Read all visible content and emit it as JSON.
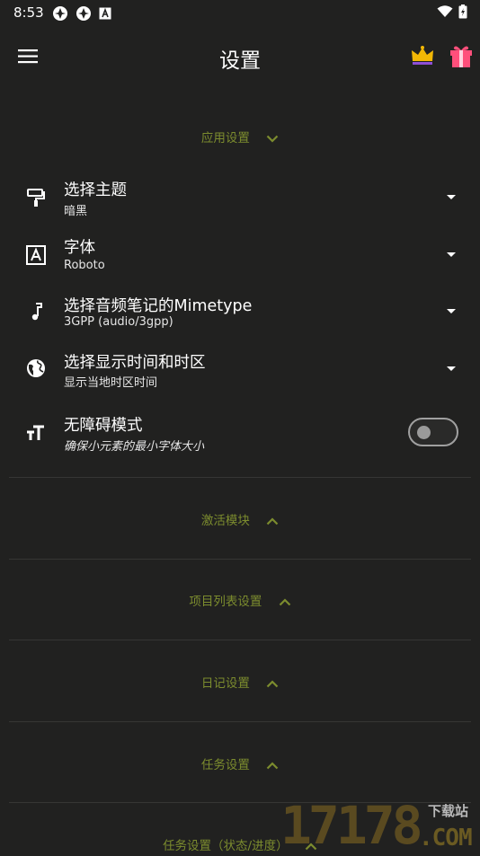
{
  "status": {
    "time": "8:53"
  },
  "title": "设置",
  "sections": {
    "app": "应用设置",
    "modules": "激活模块",
    "projects": "项目列表设置",
    "journal": "日记设置",
    "tasks": "任务设置",
    "task_status": "任务设置（状态/进度）"
  },
  "settings": [
    {
      "label": "选择主题",
      "value": "暗黑",
      "icon": "paint-roller-icon"
    },
    {
      "label": "字体",
      "value": "Roboto",
      "icon": "font-icon"
    },
    {
      "label": "选择音频笔记的Mimetype",
      "value": "3GPP (audio/3gpp)",
      "icon": "music-note-icon"
    },
    {
      "label": "选择显示时间和时区",
      "value": "显示当地时区时间",
      "icon": "globe-icon"
    },
    {
      "label": "无障碍模式",
      "value": "确保小元素的最小字体大小",
      "icon": "text-size-icon",
      "toggle_on": false
    }
  ],
  "watermark": {
    "number": "17178",
    "site": "下载站",
    "domain": ".COM"
  },
  "colors": {
    "background": "#212120",
    "accent": "#7c8c2e",
    "text": "#ffffff"
  }
}
